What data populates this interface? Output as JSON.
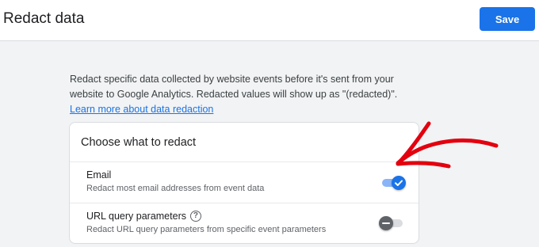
{
  "header": {
    "title": "Redact data",
    "save_label": "Save"
  },
  "intro": {
    "description": "Redact specific data collected by website events before it's sent from your website to Google Analytics. Redacted values will show up as \"(redacted)\".",
    "learn_more_label": "Learn more about data redaction"
  },
  "card": {
    "title": "Choose what to redact",
    "rows": [
      {
        "label": "Email",
        "description": "Redact most email addresses from event data",
        "enabled": true,
        "has_help_icon": false
      },
      {
        "label": "URL query parameters",
        "description": "Redact URL query parameters from specific event parameters",
        "enabled": false,
        "has_help_icon": true
      }
    ]
  },
  "colors": {
    "accent": "#1a73e8",
    "annotation_arrow": "#e3000f"
  },
  "icons": {
    "toggle_on": "check-icon",
    "toggle_off": "minus-icon",
    "help": "question-mark-circle-icon"
  }
}
